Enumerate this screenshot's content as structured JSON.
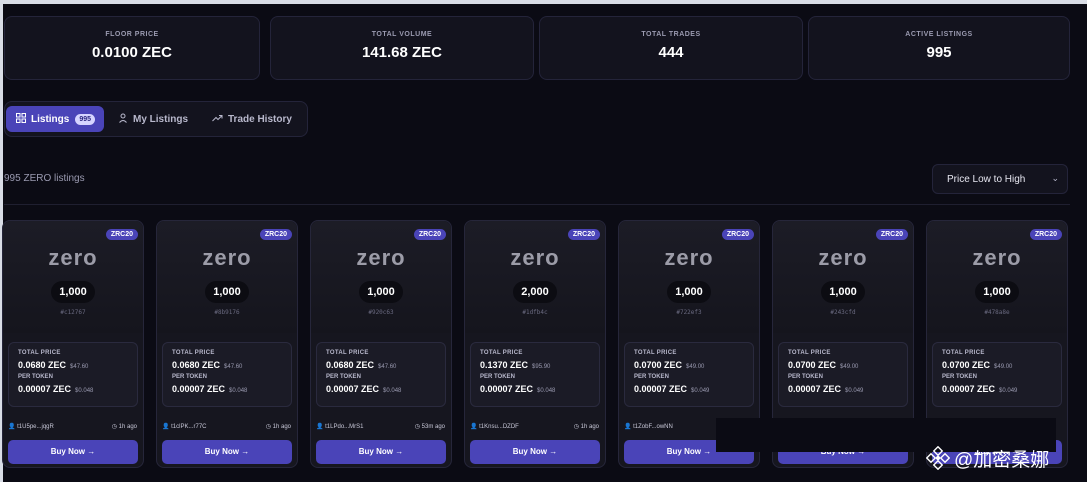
{
  "stats": [
    {
      "label": "FLOOR PRICE",
      "value": "0.0100 ZEC"
    },
    {
      "label": "TOTAL VOLUME",
      "value": "141.68 ZEC"
    },
    {
      "label": "TOTAL TRADES",
      "value": "444"
    },
    {
      "label": "ACTIVE LISTINGS",
      "value": "995"
    }
  ],
  "tabs": {
    "listings": "Listings",
    "listings_badge": "995",
    "my_listings": "My Listings",
    "trade_history": "Trade History"
  },
  "listing_count": "995 ZERO listings",
  "sort": {
    "selected": "Price Low to High"
  },
  "card_common": {
    "badge": "ZRC20",
    "logo": "zero",
    "total_price_label": "TOTAL PRICE",
    "per_token_label": "PER TOKEN",
    "buy_label": "Buy Now →"
  },
  "cards": [
    {
      "amount": "1,000",
      "hash": "#c12767",
      "total_zec": "0.0680 ZEC",
      "total_usd": "$47.60",
      "per_zec": "0.00007 ZEC",
      "per_usd": "$0.048",
      "seller": "t1U5pe...jqgR",
      "ago": "1h ago"
    },
    {
      "amount": "1,000",
      "hash": "#8b9176",
      "total_zec": "0.0680 ZEC",
      "total_usd": "$47.60",
      "per_zec": "0.00007 ZEC",
      "per_usd": "$0.048",
      "seller": "t1clPK...r77C",
      "ago": "1h ago"
    },
    {
      "amount": "1,000",
      "hash": "#920c63",
      "total_zec": "0.0680 ZEC",
      "total_usd": "$47.60",
      "per_zec": "0.00007 ZEC",
      "per_usd": "$0.048",
      "seller": "t1LPdo...MrS1",
      "ago": "53m ago"
    },
    {
      "amount": "2,000",
      "hash": "#1dfb4c",
      "total_zec": "0.1370 ZEC",
      "total_usd": "$95.90",
      "per_zec": "0.00007 ZEC",
      "per_usd": "$0.048",
      "seller": "t1Knsu...DZDF",
      "ago": "1h ago"
    },
    {
      "amount": "1,000",
      "hash": "#722ef3",
      "total_zec": "0.0700 ZEC",
      "total_usd": "$49.00",
      "per_zec": "0.00007 ZEC",
      "per_usd": "$0.049",
      "seller": "t1ZobF...owNN",
      "ago": ""
    },
    {
      "amount": "1,000",
      "hash": "#243cfd",
      "total_zec": "0.0700 ZEC",
      "total_usd": "$49.00",
      "per_zec": "0.00007 ZEC",
      "per_usd": "$0.049",
      "seller": "",
      "ago": ""
    },
    {
      "amount": "1,000",
      "hash": "#478a8e",
      "total_zec": "0.0700 ZEC",
      "total_usd": "$49.00",
      "per_zec": "0.00007 ZEC",
      "per_usd": "$0.049",
      "seller": "",
      "ago": ""
    }
  ],
  "watermark": "@加密桑娜",
  "colors": {
    "accent": "#4a44b8",
    "background": "#0b0b14",
    "card": "#16161f"
  }
}
